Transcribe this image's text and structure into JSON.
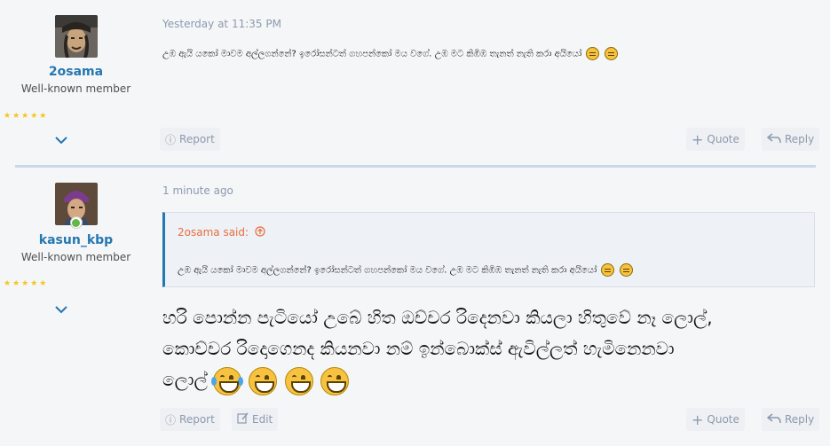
{
  "posts": [
    {
      "username": "2osama",
      "user_title": "Well-known member",
      "stars": "★★★★★",
      "expand_icon": "chevron-down-icon",
      "time": "Yesterday at 11:35 PM",
      "message": "උඹ ඇයි යකෝ මාවම අල්ලගන්නේ? ඉරෝසන්ටත් ගහපන්කෝ මය වගේ. උඹ මට කිඹිඹ තැනත් නැති කරා අයියෝ",
      "actions": {
        "report": "Report",
        "quote": "Quote",
        "reply": "Reply"
      }
    },
    {
      "username": "kasun_kbp",
      "user_title": "Well-known member",
      "stars": "★★★★★",
      "expand_icon": "chevron-down-icon",
      "time": "1 minute ago",
      "quote": {
        "author": "2osama said:",
        "text": "උඹ ඇයි යකෝ මාවම අල්ලගන්නේ? ඉරෝසන්ටත් ගහපන්කෝ මය වගේ. උඹ මට කිඹිඹ තැනත් නැති කරා අයියෝ"
      },
      "message_line1": "හරි පොන්න පැටියෝ උබේ හිත ඔච්චර රිදෙනවා කියලා හිතුවේ නෑ ලොල්,",
      "message_line2": "කොච්චර රිදොගෙනද කියනවා නම් ඉන්බොක්ස් ඇවිල්ලත් හැමිනෙනවා",
      "message_line3": "ලොල්",
      "actions": {
        "report": "Report",
        "edit": "Edit",
        "quote": "Quote",
        "reply": "Reply"
      }
    }
  ],
  "colors": {
    "link": "#2577b1",
    "quote_author": "#e86e3c",
    "muted": "#8c9aae",
    "star": "#f5c518"
  }
}
